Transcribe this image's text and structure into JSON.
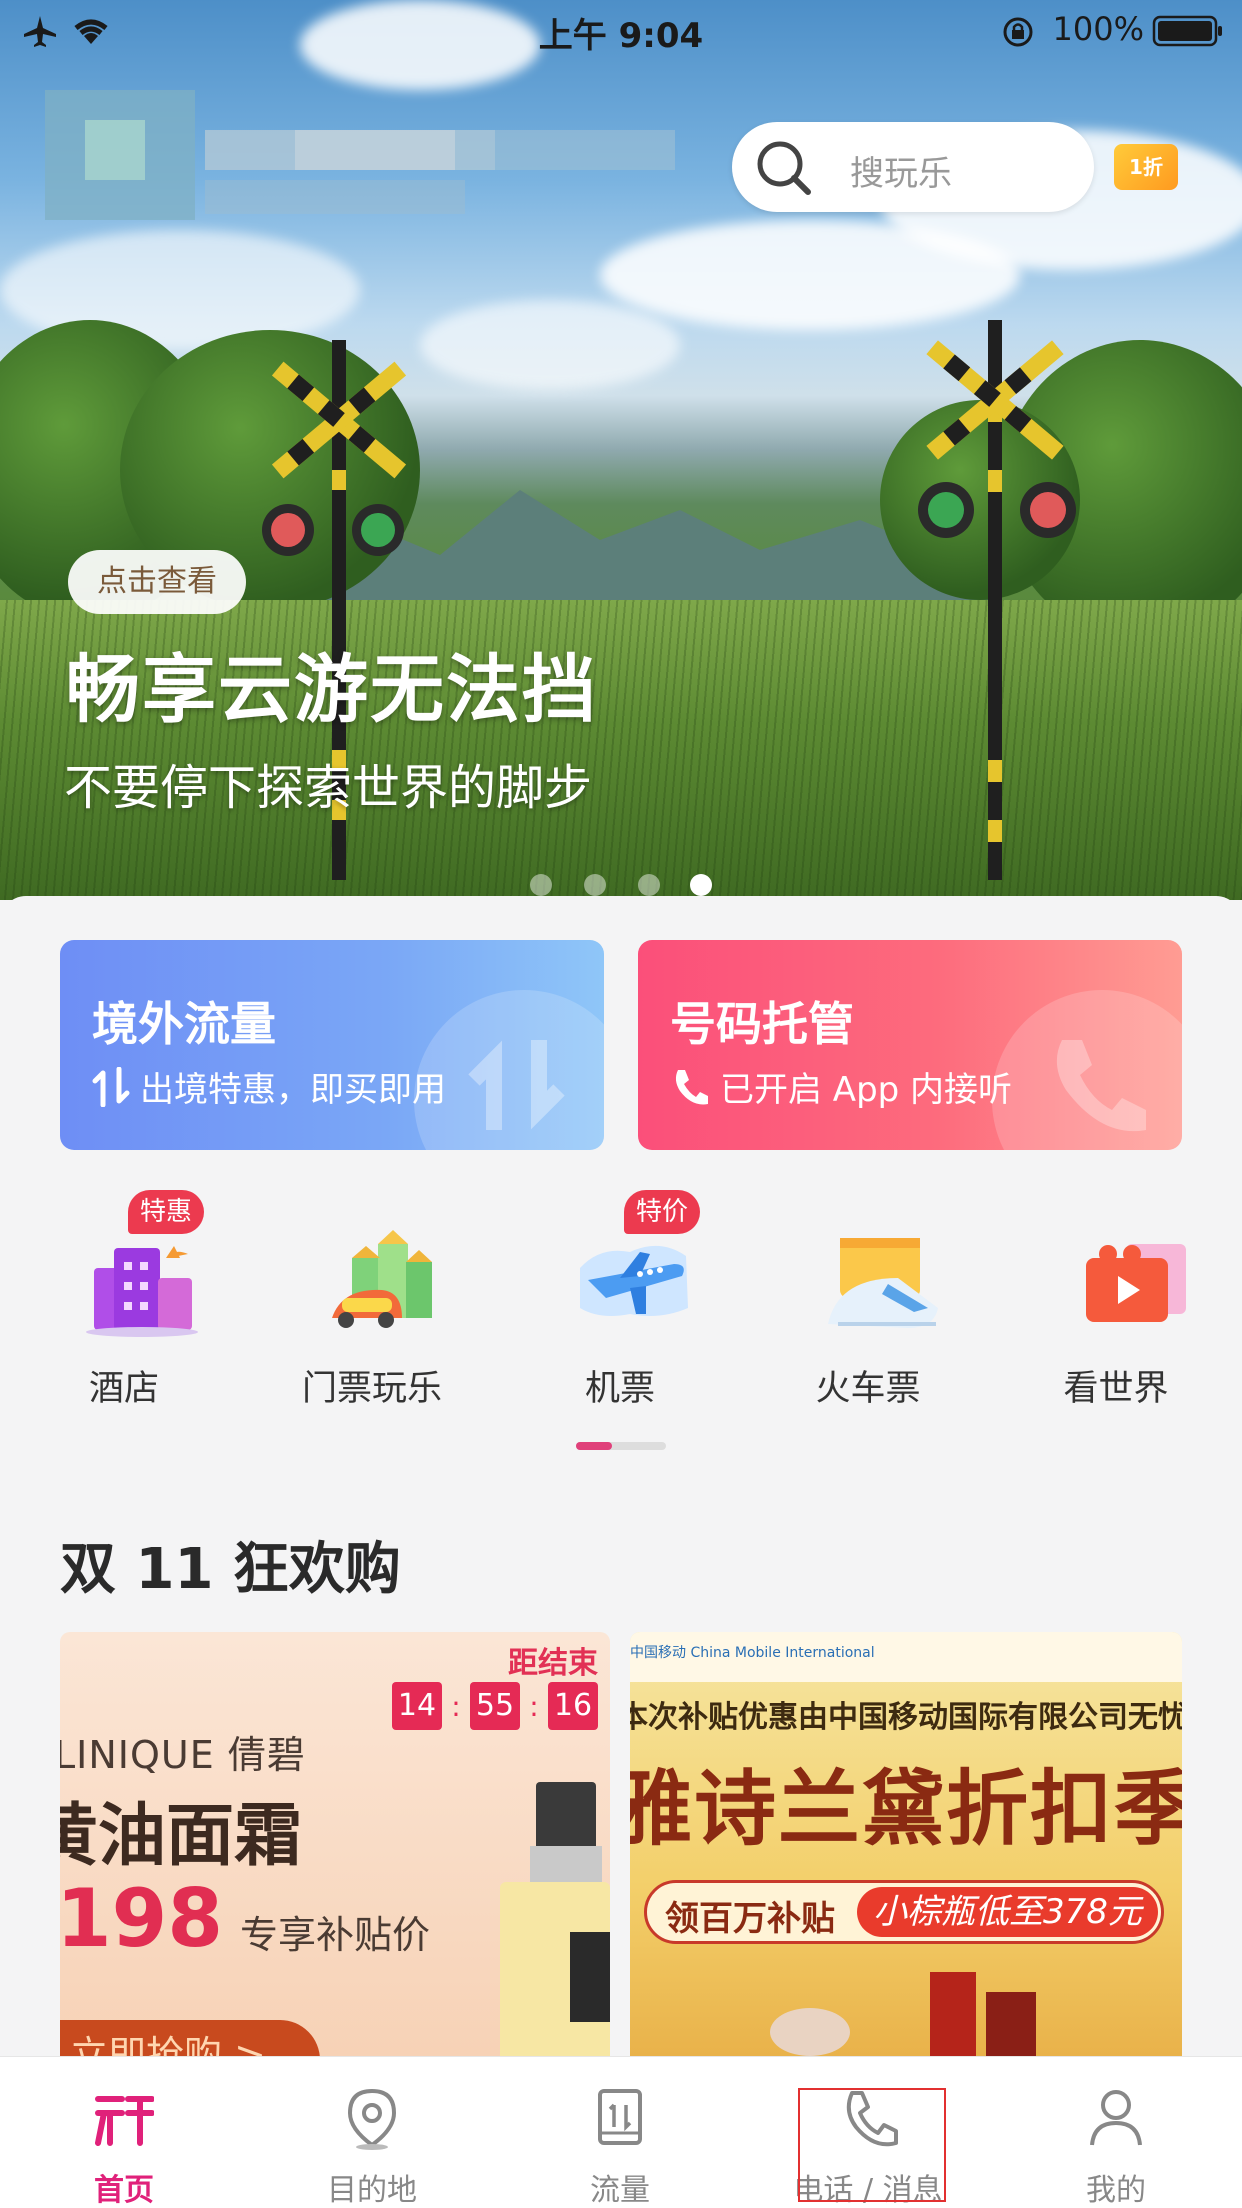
{
  "status_bar": {
    "time": "上午 9:04",
    "battery": "100%",
    "icons": [
      "airplane-icon",
      "wifi-icon",
      "rotation-lock-icon",
      "battery-icon"
    ]
  },
  "header": {
    "search_placeholder": "搜玩乐",
    "discount_badge": "1折"
  },
  "hero": {
    "cta": "点击查看",
    "title": "畅享云游无法挡",
    "subtitle": "不要停下探索世界的脚步",
    "carousel_index": 4,
    "carousel_total": 4
  },
  "promos": [
    {
      "title": "境外流量",
      "subtitle": "出境特惠，即买即用",
      "icon": "data-transfer-icon"
    },
    {
      "title": "号码托管",
      "subtitle": "已开启 App 内接听",
      "icon": "phone-icon"
    }
  ],
  "categories": [
    {
      "label": "酒店",
      "tag": "特惠",
      "icon": "hotel-icon"
    },
    {
      "label": "门票玩乐",
      "tag": "",
      "icon": "castle-icon"
    },
    {
      "label": "机票",
      "tag": "特价",
      "icon": "airplane-icon"
    },
    {
      "label": "火车票",
      "tag": "",
      "icon": "train-icon"
    },
    {
      "label": "看世界",
      "tag": "",
      "icon": "video-icon"
    }
  ],
  "section": {
    "title": "双 11 狂欢购"
  },
  "banner_left": {
    "countdown_label": "距结束",
    "hours": "14",
    "minutes": "55",
    "seconds": "16",
    "brand": "LINIQUE 倩碧",
    "product": "黄油面霜",
    "price": "198",
    "price_note": "专享补贴价",
    "buy": "立即抢购 >"
  },
  "banner_right": {
    "logo": "中国移动 China Mobile International",
    "note": "本次补贴优惠由中国移动国际有限公司无忧行提供",
    "title": "雅诗兰黛折扣季",
    "strip_left": "领百万补贴",
    "strip_right": "小棕瓶低至378元"
  },
  "tabbar": [
    {
      "label": "首页",
      "icon": "home-logo-icon",
      "active": true
    },
    {
      "label": "目的地",
      "icon": "location-pin-icon",
      "active": false
    },
    {
      "label": "流量",
      "icon": "data-usage-icon",
      "active": false
    },
    {
      "label": "电话 / 消息",
      "icon": "phone-icon",
      "active": false
    },
    {
      "label": "我的",
      "icon": "user-icon",
      "active": false
    }
  ],
  "colors": {
    "accent": "#e0217a",
    "promo_blue": "#6e8ef5",
    "promo_red": "#fb4f7a",
    "tag_red": "#ec3a4f"
  }
}
